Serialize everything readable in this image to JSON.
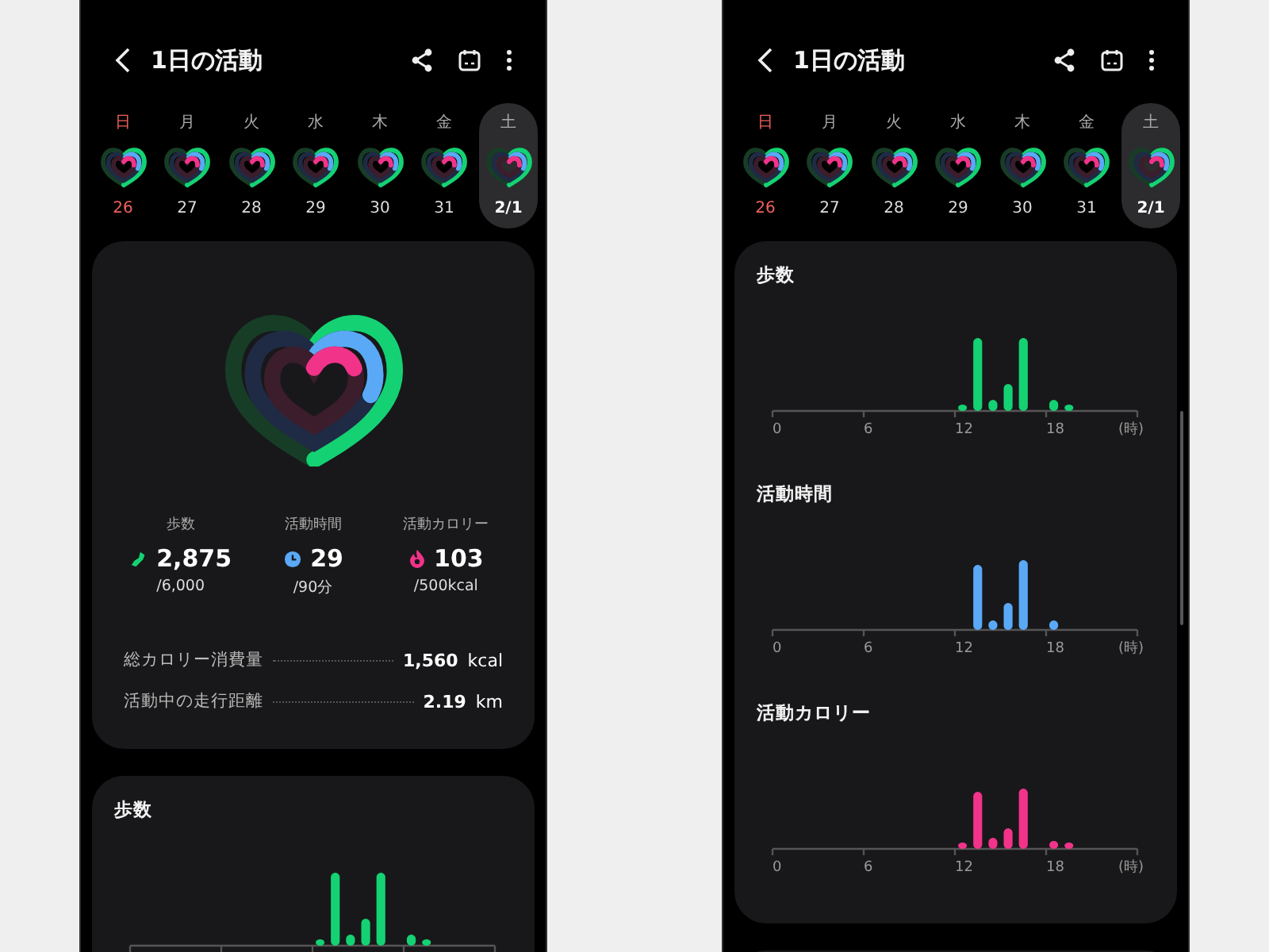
{
  "screens": [
    {
      "header": {
        "title": "1日の活動"
      },
      "week": [
        {
          "weekday": "日",
          "date": "26",
          "holiday": true,
          "selected": false
        },
        {
          "weekday": "月",
          "date": "27",
          "holiday": false,
          "selected": false
        },
        {
          "weekday": "火",
          "date": "28",
          "holiday": false,
          "selected": false
        },
        {
          "weekday": "水",
          "date": "29",
          "holiday": false,
          "selected": false
        },
        {
          "weekday": "木",
          "date": "30",
          "holiday": false,
          "selected": false
        },
        {
          "weekday": "金",
          "date": "31",
          "holiday": false,
          "selected": false
        },
        {
          "weekday": "土",
          "date": "2/1",
          "holiday": false,
          "selected": true
        }
      ],
      "sections": [
        {
          "kind": "summary",
          "stats": [
            {
              "kind": "steps",
              "label": "歩数",
              "value": "2,875",
              "goal": "/6,000"
            },
            {
              "kind": "time",
              "label": "活動時間",
              "value": "29",
              "goal": "/90分"
            },
            {
              "kind": "calories",
              "label": "活動カロリー",
              "value": "103",
              "goal": "/500kcal"
            }
          ],
          "rows": [
            {
              "label": "総カロリー消費量",
              "value": "1,560",
              "unit": "kcal"
            },
            {
              "label": "活動中の走行距離",
              "value": "2.19",
              "unit": "km"
            }
          ]
        },
        {
          "kind": "charts",
          "charts": [
            {
              "kind": "steps",
              "title": "歩数"
            }
          ]
        }
      ]
    },
    {
      "header": {
        "title": "1日の活動"
      },
      "week": [
        {
          "weekday": "日",
          "date": "26",
          "holiday": true,
          "selected": false
        },
        {
          "weekday": "月",
          "date": "27",
          "holiday": false,
          "selected": false
        },
        {
          "weekday": "火",
          "date": "28",
          "holiday": false,
          "selected": false
        },
        {
          "weekday": "水",
          "date": "29",
          "holiday": false,
          "selected": false
        },
        {
          "weekday": "木",
          "date": "30",
          "holiday": false,
          "selected": false
        },
        {
          "weekday": "金",
          "date": "31",
          "holiday": false,
          "selected": false
        },
        {
          "weekday": "土",
          "date": "2/1",
          "holiday": false,
          "selected": true
        }
      ],
      "sections": [
        {
          "kind": "charts",
          "charts": [
            {
              "kind": "steps",
              "title": "歩数",
              "ticks": [
                "0",
                "6",
                "12",
                "18"
              ],
              "unit": "(時)"
            },
            {
              "kind": "time",
              "title": "活動時間",
              "ticks": [
                "0",
                "6",
                "12",
                "18"
              ],
              "unit": "(時)"
            },
            {
              "kind": "calories",
              "title": "活動カロリー",
              "ticks": [
                "0",
                "6",
                "12",
                "18"
              ],
              "unit": "(時)"
            }
          ]
        },
        {
          "kind": "more"
        }
      ]
    }
  ]
}
